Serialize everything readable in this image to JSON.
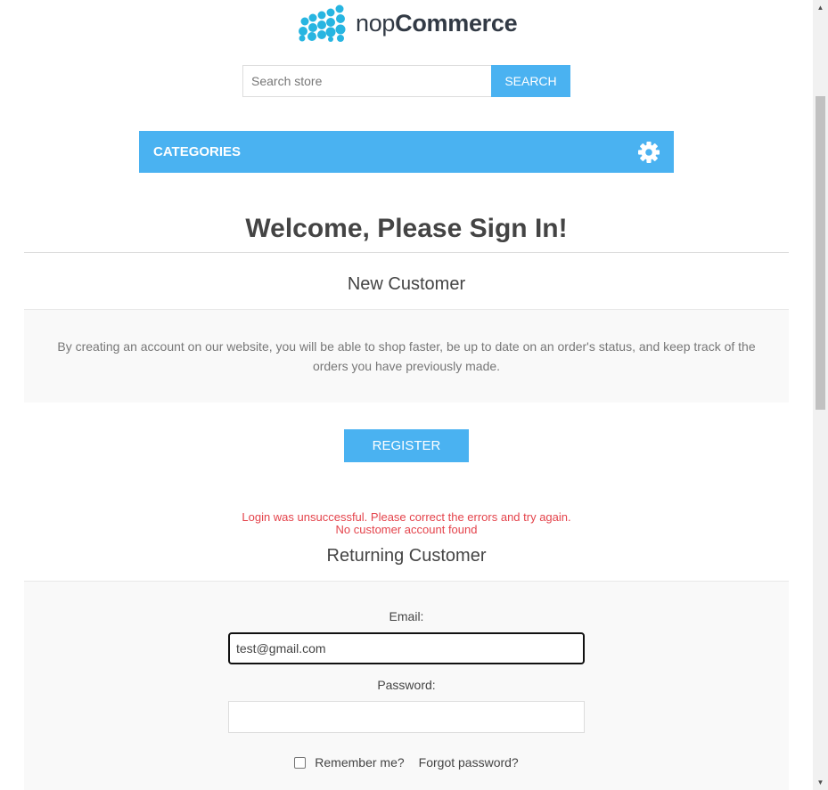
{
  "header": {
    "logo": {
      "text_part1": "nop",
      "text_part2": "Commerce",
      "mark_color": "#27b5e1"
    },
    "search": {
      "placeholder": "Search store",
      "button_label": "SEARCH"
    },
    "categories": {
      "label": "CATEGORIES",
      "icon": "gear-icon"
    }
  },
  "main": {
    "title": "Welcome, Please Sign In!",
    "new_customer": {
      "title": "New Customer",
      "text": "By creating an account on our website, you will be able to shop faster, be up to date on an order's status, and keep track of the orders you have previously made.",
      "register_label": "REGISTER"
    },
    "errors": [
      "Login was unsuccessful. Please correct the errors and try again.",
      "No customer account found"
    ],
    "returning_customer": {
      "title": "Returning Customer",
      "email_label": "Email:",
      "email_value": "test@gmail.com",
      "password_label": "Password:",
      "password_value": "",
      "remember_label": "Remember me?",
      "forgot_label": "Forgot password?"
    }
  },
  "colors": {
    "accent": "#4ab2f1",
    "error": "#e4434b",
    "logo_dots": "#27b5e1"
  },
  "scrollbar": {
    "up_icon": "▲",
    "down_icon": "▼"
  }
}
